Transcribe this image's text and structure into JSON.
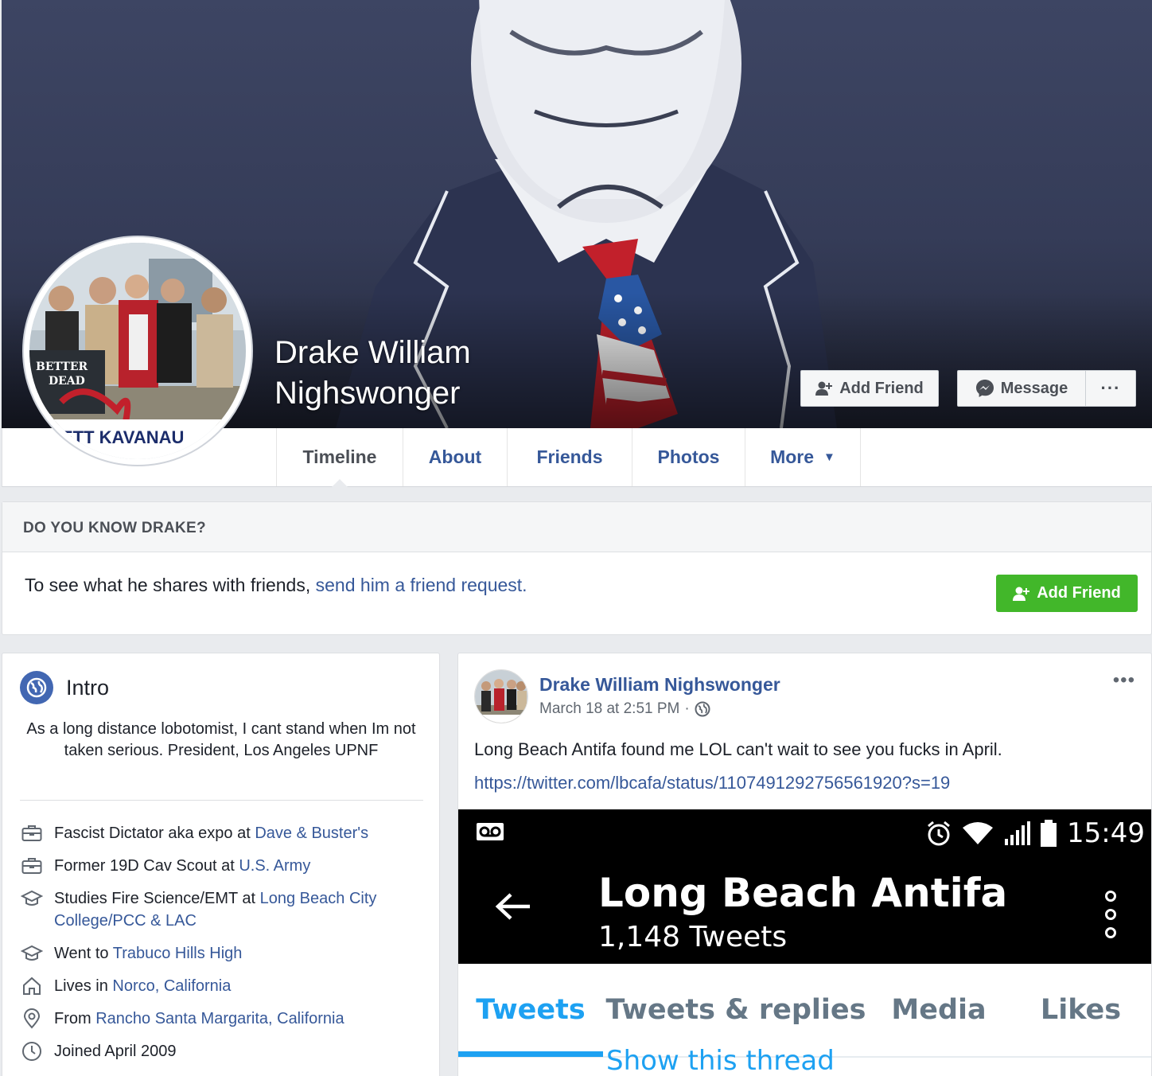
{
  "profile": {
    "name_line1": "Drake William",
    "name_line2": "Nighswonger",
    "pic_text_top": "BETTER",
    "pic_text_bottom": "DEAD",
    "pic_banner": "ETT KAVANAU"
  },
  "cover_actions": {
    "add_friend": "Add Friend",
    "message": "Message",
    "more": "···"
  },
  "tabs": [
    {
      "label": "Timeline",
      "active": true
    },
    {
      "label": "About"
    },
    {
      "label": "Friends"
    },
    {
      "label": "Photos"
    },
    {
      "label": "More"
    }
  ],
  "know_box": {
    "heading": "DO YOU KNOW DRAKE?",
    "text": "To see what he shares with friends,",
    "link": "send him a friend request.",
    "button": "Add Friend"
  },
  "intro": {
    "title": "Intro",
    "bio": "As a long distance lobotomist, I cant stand when Im not taken serious. President, Los Angeles UPNF",
    "items": [
      {
        "icon": "briefcase-icon",
        "text": "Fascist Dictator aka expo at ",
        "link": "Dave & Buster's"
      },
      {
        "icon": "briefcase-icon",
        "text": "Former 19D Cav Scout at ",
        "link": "U.S. Army"
      },
      {
        "icon": "graduation-cap-icon",
        "text": "Studies Fire Science/EMT at ",
        "link": "Long Beach City College/PCC & LAC"
      },
      {
        "icon": "graduation-cap-icon",
        "text": "Went to ",
        "link": "Trabuco Hills High"
      },
      {
        "icon": "home-icon",
        "text": "Lives in ",
        "link": "Norco, California"
      },
      {
        "icon": "location-pin-icon",
        "text": "From ",
        "link": "Rancho Santa Margarita, California"
      },
      {
        "icon": "clock-icon",
        "text": "Joined April 2009",
        "link": ""
      }
    ]
  },
  "post": {
    "author": "Drake William Nighswonger",
    "date": "March 18 at 2:51 PM",
    "separator": "·",
    "menu": "•••",
    "text": "Long Beach Antifa found me LOL can't wait to see you fucks in April.",
    "url": "https://twitter.com/lbcafa/status/1107491292756561920?s=19"
  },
  "embedded": {
    "time": "15:49",
    "account": "Long Beach Antifa",
    "tweet_count": "1,148 Tweets",
    "tabs": [
      "Tweets",
      "Tweets & replies",
      "Media",
      "Likes"
    ],
    "thread_link": "Show this thread"
  },
  "colors": {
    "link": "#365899",
    "green": "#42b72a",
    "twitter_blue": "#1da1f2"
  }
}
